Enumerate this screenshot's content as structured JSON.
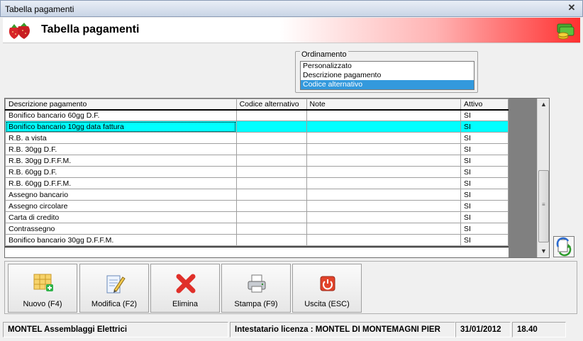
{
  "window": {
    "title": "Tabella pagamenti"
  },
  "header": {
    "title": "Tabella pagamenti"
  },
  "ordinamento": {
    "legend": "Ordinamento",
    "options": [
      "Personalizzato",
      "Descrizione pagamento",
      "Codice alternativo"
    ],
    "selected": "Codice alternativo"
  },
  "table": {
    "columns": [
      "Descrizione pagamento",
      "Codice alternativo",
      "Note",
      "Attivo"
    ],
    "rows": [
      [
        "Bonifico bancario 60gg D.F.",
        "",
        "",
        "SI"
      ],
      [
        "Bonifico bancario 10gg data fattura",
        "",
        "",
        "SI"
      ],
      [
        "R.B. a vista",
        "",
        "",
        "SI"
      ],
      [
        "R.B. 30gg D.F.",
        "",
        "",
        "SI"
      ],
      [
        "R.B. 30gg D.F.F.M.",
        "",
        "",
        "SI"
      ],
      [
        "R.B. 60gg D.F.",
        "",
        "",
        "SI"
      ],
      [
        "R.B. 60gg D.F.F.M.",
        "",
        "",
        "SI"
      ],
      [
        "Assegno bancario",
        "",
        "",
        "SI"
      ],
      [
        "Assegno circolare",
        "",
        "",
        "SI"
      ],
      [
        "Carta di credito",
        "",
        "",
        "SI"
      ],
      [
        "Contrassegno",
        "",
        "",
        "SI"
      ],
      [
        "Bonifico bancario 30gg D.F.F.M.",
        "",
        "",
        "SI"
      ]
    ],
    "selected_row": 1
  },
  "toolbar": {
    "buttons": [
      {
        "label": "Nuovo (F4)",
        "icon": "new-grid-icon"
      },
      {
        "label": "Modifica (F2)",
        "icon": "edit-pencil-icon"
      },
      {
        "label": "Elimina",
        "icon": "delete-x-icon"
      },
      {
        "label": "Stampa (F9)",
        "icon": "printer-icon"
      },
      {
        "label": "Uscita (ESC)",
        "icon": "exit-power-icon"
      }
    ]
  },
  "status": {
    "company": "MONTEL Assemblaggi Elettrici",
    "license": "Intestatario licenza : MONTEL DI MONTEMAGNI PIER",
    "date": "31/01/2012",
    "time": "18.40"
  },
  "colors": {
    "selected_row": "#00ffff",
    "list_selection": "#3399dd",
    "header_gradient_end": "#ff3030"
  }
}
